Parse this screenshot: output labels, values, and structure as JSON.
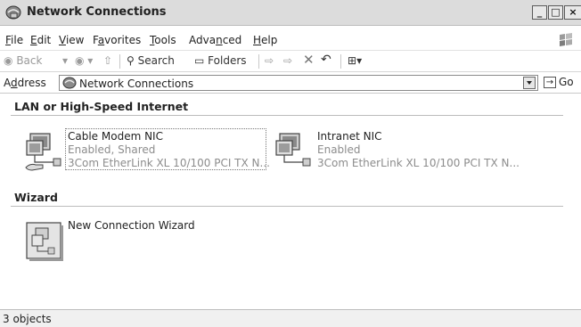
{
  "window": {
    "title": "Network Connections",
    "controls": {
      "minimize": "_",
      "maximize": "□",
      "close": "×"
    }
  },
  "menu": {
    "items": [
      {
        "pre": "",
        "key": "F",
        "post": "ile"
      },
      {
        "pre": "",
        "key": "E",
        "post": "dit"
      },
      {
        "pre": "",
        "key": "V",
        "post": "iew"
      },
      {
        "pre": "F",
        "key": "a",
        "post": "vorites"
      },
      {
        "pre": "",
        "key": "T",
        "post": "ools"
      },
      {
        "pre": "Adva",
        "key": "n",
        "post": "ced"
      },
      {
        "pre": "",
        "key": "H",
        "post": "elp"
      }
    ]
  },
  "toolbar": {
    "back": "Back",
    "search": "Search",
    "folders": "Folders"
  },
  "address": {
    "label_pre": "A",
    "label_key": "d",
    "label_post": "dress",
    "value": "Network Connections",
    "go": "Go"
  },
  "sections": {
    "lan": {
      "heading": "LAN or High-Speed Internet",
      "items": [
        {
          "name": "Cable Modem NIC",
          "status": "Enabled, Shared",
          "device": "3Com EtherLink XL 10/100 PCI TX N..."
        },
        {
          "name": "Intranet NIC",
          "status": "Enabled",
          "device": "3Com EtherLink XL 10/100 PCI TX N..."
        }
      ]
    },
    "wizard": {
      "heading": "Wizard",
      "items": [
        {
          "name": "New Connection Wizard"
        }
      ]
    }
  },
  "status": {
    "text": "3 objects"
  },
  "icons": {
    "window": "network-connections-icon",
    "connection": "network-connection-icon",
    "shared": "shared-hand-icon",
    "wizard": "new-connection-wizard-icon"
  }
}
